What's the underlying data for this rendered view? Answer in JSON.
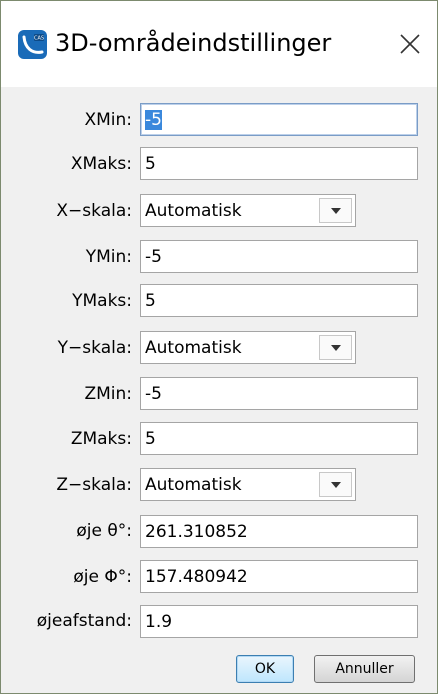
{
  "dialog": {
    "title": "3D-områdeindstillinger",
    "close_icon": "close-icon",
    "app_icon": "cas-app-icon",
    "accent_color": "#1a6bb8"
  },
  "fields": [
    {
      "label": "XMin:",
      "value": "-5",
      "type": "text",
      "focused": true,
      "selected": true
    },
    {
      "label": "XMaks:",
      "value": "5",
      "type": "text"
    },
    {
      "label": "X−skala:",
      "value": "Automatisk",
      "type": "dropdown"
    },
    {
      "label": "YMin:",
      "value": "-5",
      "type": "text"
    },
    {
      "label": "YMaks:",
      "value": "5",
      "type": "text"
    },
    {
      "label": "Y−skala:",
      "value": "Automatisk",
      "type": "dropdown"
    },
    {
      "label": "ZMin:",
      "value": "-5",
      "type": "text"
    },
    {
      "label": "ZMaks:",
      "value": "5",
      "type": "text"
    },
    {
      "label": "Z−skala:",
      "value": "Automatisk",
      "type": "dropdown"
    },
    {
      "label": "øje θ°:",
      "value": "261.310852",
      "type": "text"
    },
    {
      "label": "øje Φ°:",
      "value": "157.480942",
      "type": "text"
    },
    {
      "label": "øjeafstand:",
      "value": "1.9",
      "type": "text"
    }
  ],
  "buttons": {
    "ok": "OK",
    "cancel": "Annuller"
  }
}
